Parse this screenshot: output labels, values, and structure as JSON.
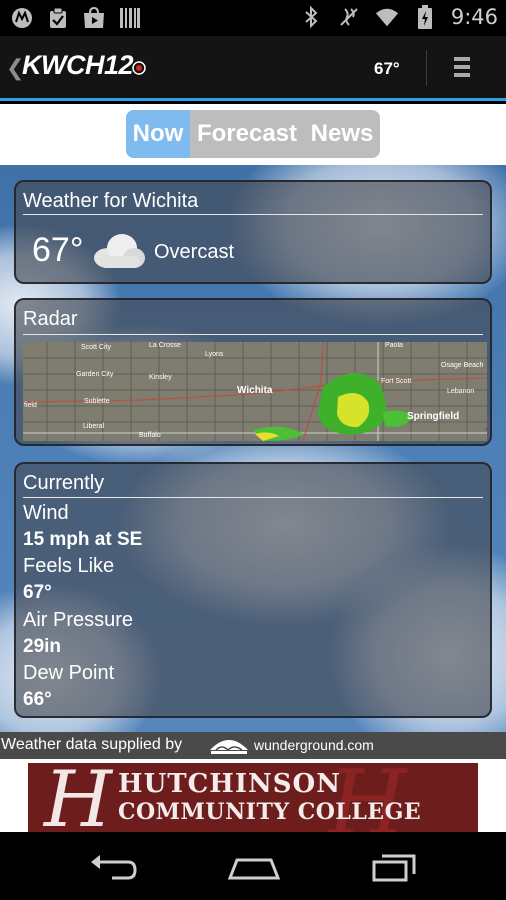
{
  "status_bar": {
    "time": "9:46",
    "left_icons": [
      "motorola-icon",
      "clipboard-check-icon",
      "play-store-icon",
      "barcode-icon"
    ],
    "right_icons": [
      "bluetooth-icon",
      "vibrate-mute-icon",
      "wifi-icon",
      "battery-icon"
    ]
  },
  "header": {
    "logo_text": "KWCH12",
    "temperature": "67°"
  },
  "tabs": [
    {
      "label": "Now",
      "selected": true
    },
    {
      "label": "Forecast",
      "selected": false
    },
    {
      "label": "News",
      "selected": false
    }
  ],
  "weather_card": {
    "title": "Weather for Wichita",
    "temperature": "67°",
    "condition": "Overcast",
    "condition_icon": "cloud-icon"
  },
  "radar_card": {
    "title": "Radar",
    "map_labels": {
      "scott_city": "Scott City",
      "la_crosse": "La Crosse",
      "lyons": "Lyons",
      "garden_city": "Garden City",
      "kinsley": "Kinsley",
      "sublette": "Sublette",
      "field": "field",
      "liberal": "Liberal",
      "wichita": "Wichita",
      "fort_scott": "Fort Scott",
      "springfield": "Springfield",
      "lebanon": "Lebanon",
      "osage_beach": "Osage Beach",
      "paola": "Paola",
      "buffalo": "Buffalo"
    }
  },
  "currently_card": {
    "title": "Currently",
    "rows": [
      {
        "label": "Wind",
        "value": "15 mph at SE"
      },
      {
        "label": "Feels Like",
        "value": "67°"
      },
      {
        "label": "Air Pressure",
        "value": "29in"
      },
      {
        "label": "Dew Point",
        "value": "66°"
      }
    ]
  },
  "attribution": {
    "text": "Weather data supplied by",
    "brand": "wunderground.com"
  },
  "ad": {
    "line1": "HUTCHINSON",
    "line2": "COMMUNITY COLLEGE",
    "monogram": "H"
  },
  "nav_bar": {
    "buttons": [
      "back-icon",
      "home-icon",
      "recent-apps-icon"
    ]
  },
  "colors": {
    "accent_blue": "#2aa3e8",
    "tab_selected": "#7fbbef",
    "tab_bg": "#bdbdbd",
    "ad_maroon": "#6e1d1d"
  }
}
